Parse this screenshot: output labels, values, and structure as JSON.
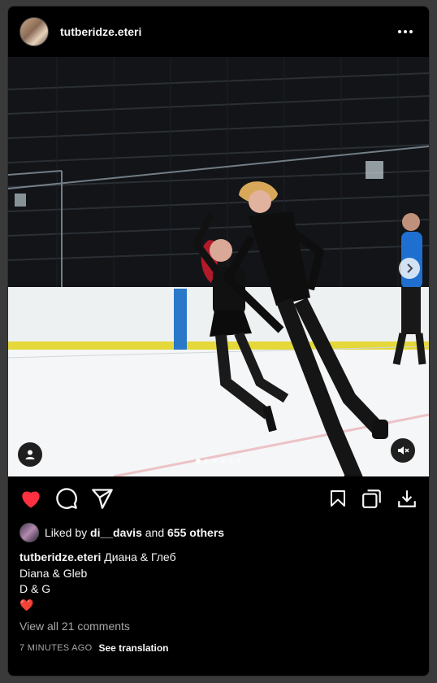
{
  "post": {
    "username": "tutberidze.eteri",
    "more_icon": "more-horizontal-icon"
  },
  "media": {
    "carousel_count": 6,
    "carousel_index": 1,
    "icons": [
      "chevron-right-icon",
      "user-tag-icon",
      "volume-muted-icon"
    ]
  },
  "actions": {
    "liked": true,
    "like_color": "#ff3040",
    "icons": [
      "heart-filled-icon",
      "comment-icon",
      "share-icon",
      "bookmark-icon",
      "collection-icon",
      "download-icon"
    ]
  },
  "likes": {
    "prefix": "Liked by",
    "user": "di__davis",
    "conjunction": "and",
    "others": "655 others"
  },
  "caption": {
    "username": "tutberidze.eteri",
    "line1": "Диана & Глеб",
    "line2": "Diana & Gleb",
    "line3": "D & G",
    "line4": "❤️"
  },
  "comments": {
    "view_all": "View all 21 comments"
  },
  "meta": {
    "time": "7 MINUTES AGO",
    "translate": "See translation"
  }
}
